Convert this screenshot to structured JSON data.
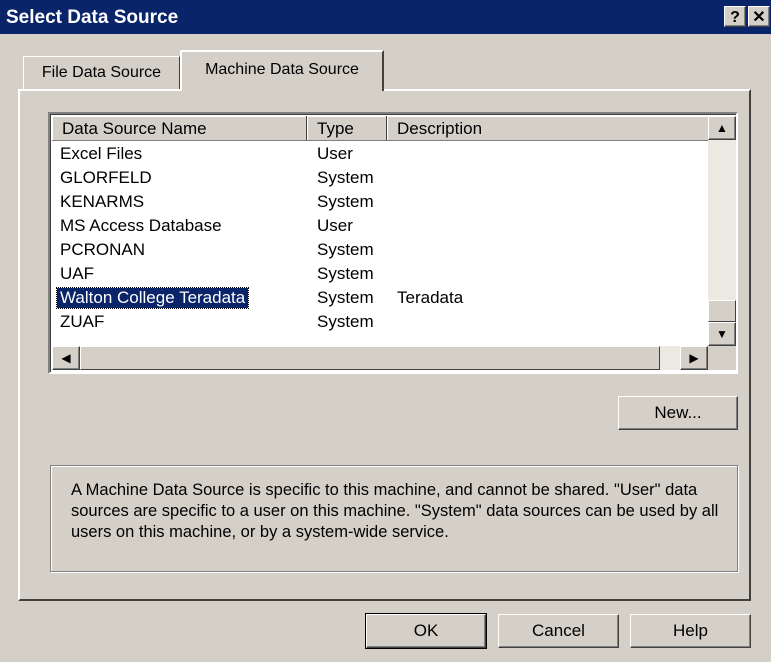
{
  "window": {
    "title": "Select Data Source",
    "help_glyph": "?",
    "close_glyph": "✕"
  },
  "tabs": [
    {
      "label": "File Data Source",
      "active": false
    },
    {
      "label": "Machine Data Source",
      "active": true
    }
  ],
  "list": {
    "columns": [
      "Data Source Name",
      "Type",
      "Description"
    ],
    "rows": [
      {
        "name": "Excel Files",
        "type": "User",
        "description": ""
      },
      {
        "name": "GLORFELD",
        "type": "System",
        "description": ""
      },
      {
        "name": "KENARMS",
        "type": "System",
        "description": ""
      },
      {
        "name": "MS Access Database",
        "type": "User",
        "description": ""
      },
      {
        "name": "PCRONAN",
        "type": "System",
        "description": ""
      },
      {
        "name": "UAF",
        "type": "System",
        "description": ""
      },
      {
        "name": "Walton College Teradata",
        "type": "System",
        "description": "Teradata"
      },
      {
        "name": "ZUAF",
        "type": "System",
        "description": ""
      }
    ],
    "selected_index": 6
  },
  "buttons": {
    "new": "New...",
    "ok": "OK",
    "cancel": "Cancel",
    "help": "Help"
  },
  "info": "A Machine Data Source is specific to this machine, and cannot be shared. \"User\" data sources are specific to a user on this machine.  \"System\" data sources can be used by all users on this machine, or by a system-wide service.",
  "scroll_icons": {
    "up": "▲",
    "down": "▼",
    "left": "◀",
    "right": "▶"
  },
  "colors": {
    "face": "#d4d0c8",
    "titlebar": "#0a246a",
    "selection": "#0a246a"
  }
}
